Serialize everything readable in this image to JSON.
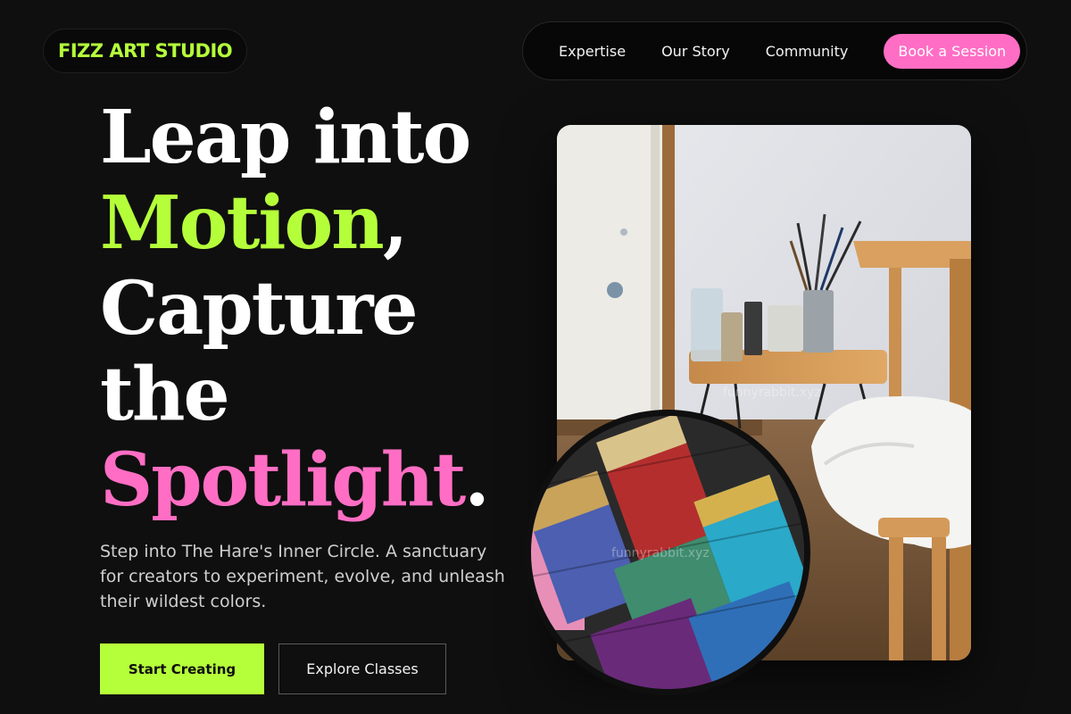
{
  "brand": {
    "name": "FIZZ ART STUDIO",
    "accent": "#b5ff3a",
    "pink": "#ff6ec4"
  },
  "nav": {
    "links": [
      "Expertise",
      "Our Story",
      "Community"
    ],
    "cta": "Book a Session"
  },
  "hero": {
    "title": {
      "line1": "Leap into",
      "line2_accent": "Motion",
      "line2_rest": ",",
      "line3": "Capture",
      "line4": "the",
      "line5_accent": "Spotlight",
      "line5_rest": "."
    },
    "subtitle": "Step into The Hare's Inner Circle. A sanctuary for creators to experiment, evolve, and unleash their wildest colors.",
    "primary_button": "Start Creating",
    "secondary_button": "Explore Classes"
  },
  "images": {
    "main_photo": "art-studio-table-photo",
    "circle_photo": "paint-brushes-photo",
    "watermark": "funnyrabbit.xyz"
  }
}
